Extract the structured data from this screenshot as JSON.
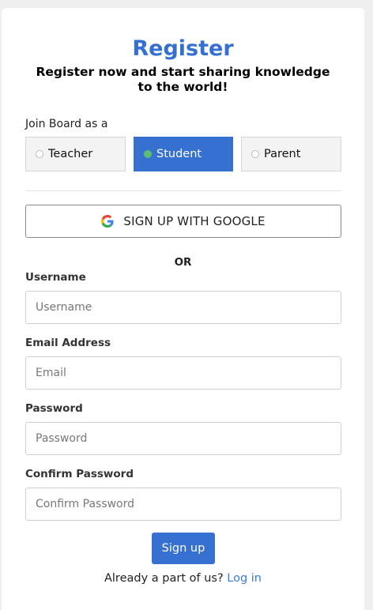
{
  "header": {
    "title": "Register",
    "subtitle": "Register now and start sharing knowledge to the world!"
  },
  "role_select": {
    "label": "Join Board as a",
    "options": [
      {
        "label": "Teacher",
        "selected": false
      },
      {
        "label": "Student",
        "selected": true
      },
      {
        "label": "Parent",
        "selected": false
      }
    ]
  },
  "google_button": {
    "label": "SIGN UP WITH GOOGLE",
    "icon": "google-icon"
  },
  "separator": {
    "text": "OR"
  },
  "fields": {
    "username": {
      "label": "Username",
      "placeholder": "Username",
      "value": ""
    },
    "email": {
      "label": "Email Address",
      "placeholder": "Email",
      "value": ""
    },
    "password": {
      "label": "Password",
      "placeholder": "Password",
      "value": ""
    },
    "confirm_password": {
      "label": "Confirm Password",
      "placeholder": "Confirm Password",
      "value": ""
    }
  },
  "submit": {
    "label": "Sign up"
  },
  "footer": {
    "text": "Already a part of us?",
    "link": "Log in"
  },
  "colors": {
    "accent": "#3470d1",
    "selected_radio": "#5cbf72",
    "link": "#3a7bd5",
    "background": "#efefef"
  }
}
